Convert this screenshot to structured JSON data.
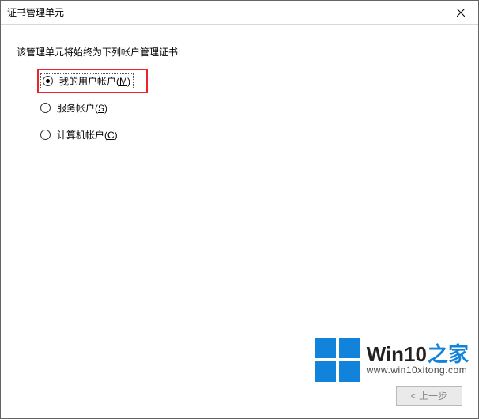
{
  "window": {
    "title": "证书管理单元"
  },
  "content": {
    "instruction": "该管理单元将始终为下列帐户管理证书:"
  },
  "radios": {
    "option1": {
      "label": "我的用户帐户(",
      "key": "M",
      "tail": ")",
      "selected": true
    },
    "option2": {
      "label": "服务帐户(",
      "key": "S",
      "tail": ")",
      "selected": false
    },
    "option3": {
      "label": "计算机帐户(",
      "key": "C",
      "tail": ")",
      "selected": false
    }
  },
  "buttons": {
    "back": "< 上一步"
  },
  "watermark": {
    "brand_a": "Win10",
    "brand_b": "之家",
    "url": "www.win10xitong.com"
  }
}
